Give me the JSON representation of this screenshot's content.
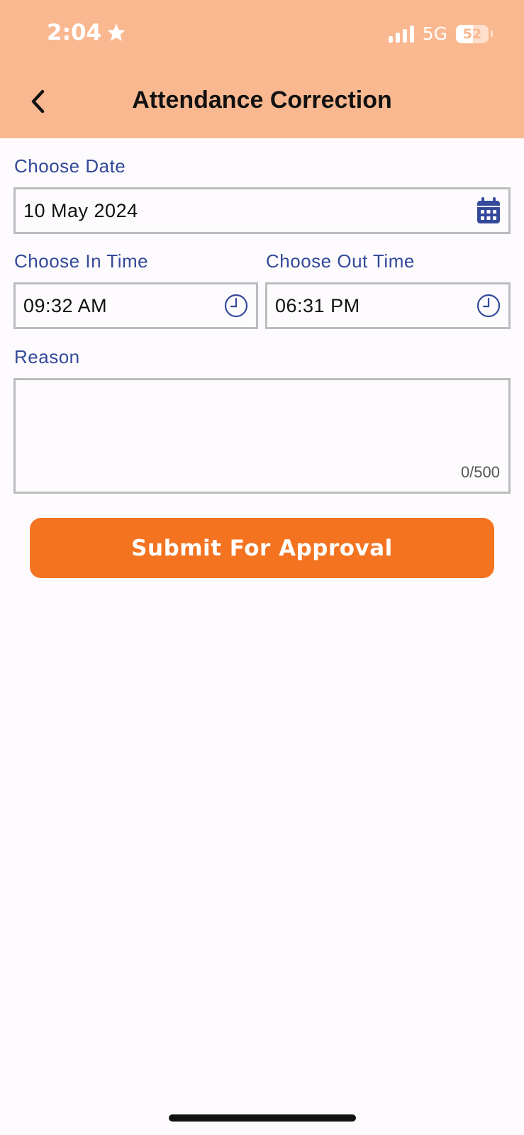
{
  "status_bar": {
    "time": "2:04",
    "network": "5G",
    "battery": "52"
  },
  "header": {
    "title": "Attendance Correction",
    "back_icon": "chevron-left-icon"
  },
  "form": {
    "date_label": "Choose Date",
    "date_value": "10 May 2024",
    "date_icon": "calendar-icon",
    "in_time_label": "Choose In Time",
    "in_time_value": "09:32 AM",
    "out_time_label": "Choose Out Time",
    "out_time_value": "06:31 PM",
    "time_icon": "clock-icon",
    "reason_label": "Reason",
    "reason_value": "",
    "reason_counter": "0/500"
  },
  "actions": {
    "submit_label": "Submit For Approval"
  },
  "colors": {
    "header_bg": "#fab890",
    "label": "#34499a",
    "button": "#f37321",
    "border": "#bdbcbf"
  }
}
